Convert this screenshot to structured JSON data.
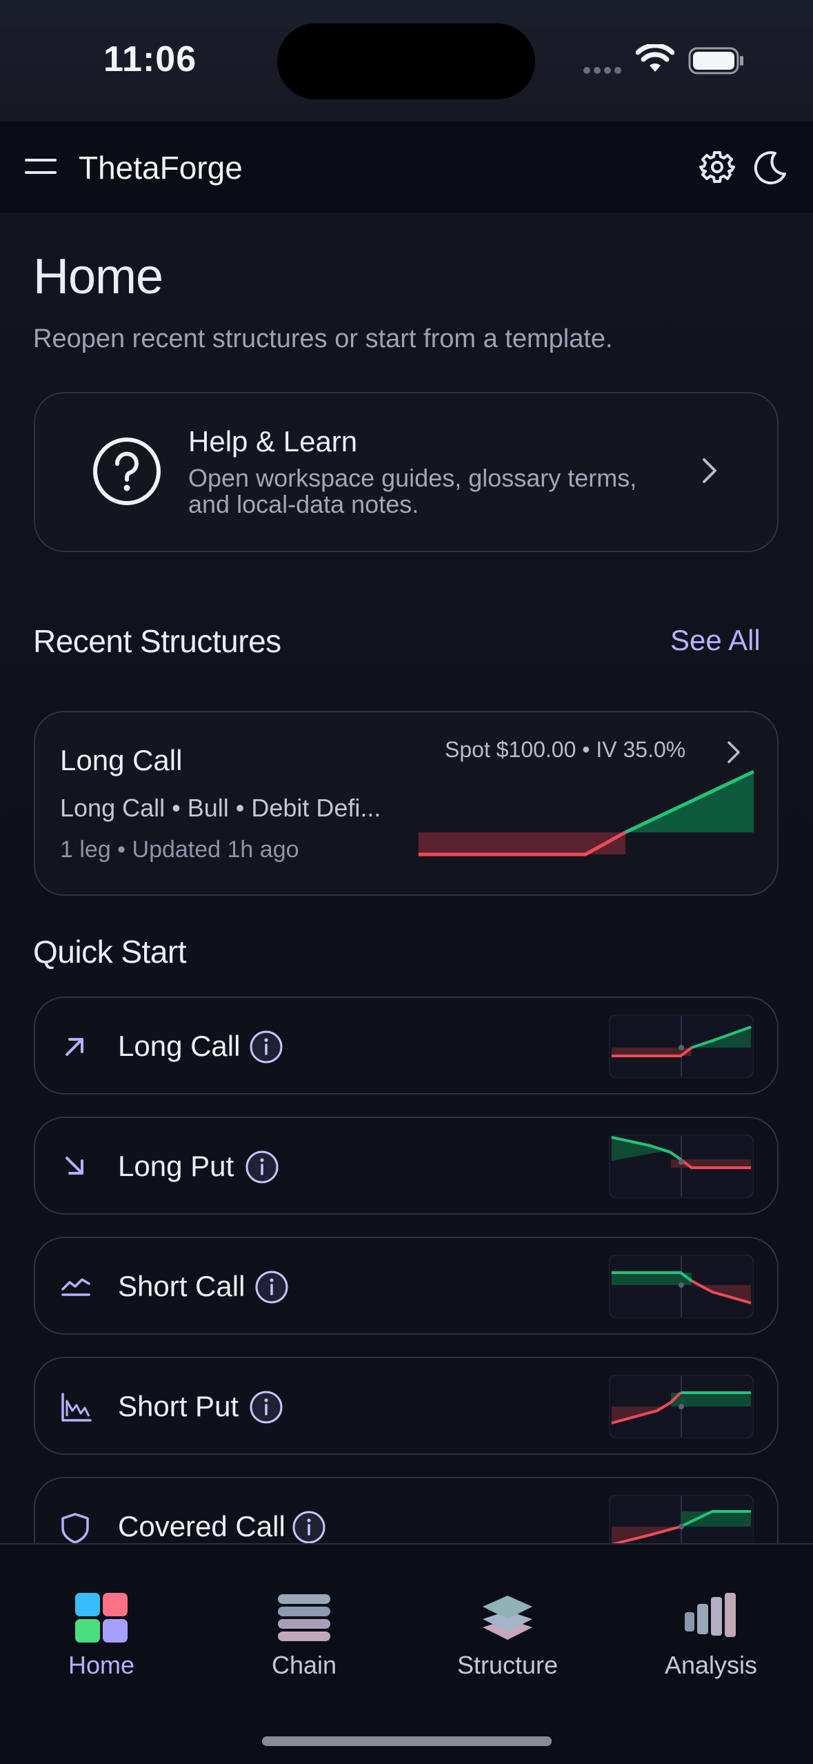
{
  "status_bar": {
    "time": "11:06"
  },
  "header": {
    "app_title": "ThetaForge"
  },
  "page": {
    "title": "Home",
    "subtitle": "Reopen recent structures or start from a template."
  },
  "help_card": {
    "title": "Help & Learn",
    "description": "Open workspace guides, glossary terms, and local-data notes."
  },
  "recent": {
    "section_title": "Recent Structures",
    "see_all_label": "See All",
    "items": [
      {
        "title": "Long Call",
        "meta": "Long Call • Bull • Debit Defi...",
        "updated": "1 leg • Updated 1h ago",
        "spot": "Spot $100.00 • IV 35.0%"
      }
    ]
  },
  "quick_start": {
    "section_title": "Quick Start",
    "items": [
      {
        "label": "Long Call",
        "icon": "arrow-up-right-icon"
      },
      {
        "label": "Long Put",
        "icon": "arrow-down-right-icon"
      },
      {
        "label": "Short Call",
        "icon": "area-chart-icon"
      },
      {
        "label": "Short Put",
        "icon": "bar-chart-icon"
      },
      {
        "label": "Covered Call",
        "icon": "shield-icon"
      }
    ]
  },
  "tabs": [
    {
      "label": "Home",
      "active": true
    },
    {
      "label": "Chain",
      "active": false
    },
    {
      "label": "Structure",
      "active": false
    },
    {
      "label": "Analysis",
      "active": false
    }
  ],
  "colors": {
    "accent": "#b7b1ff",
    "profit": "#22c47a",
    "loss": "#ee4a5a"
  }
}
